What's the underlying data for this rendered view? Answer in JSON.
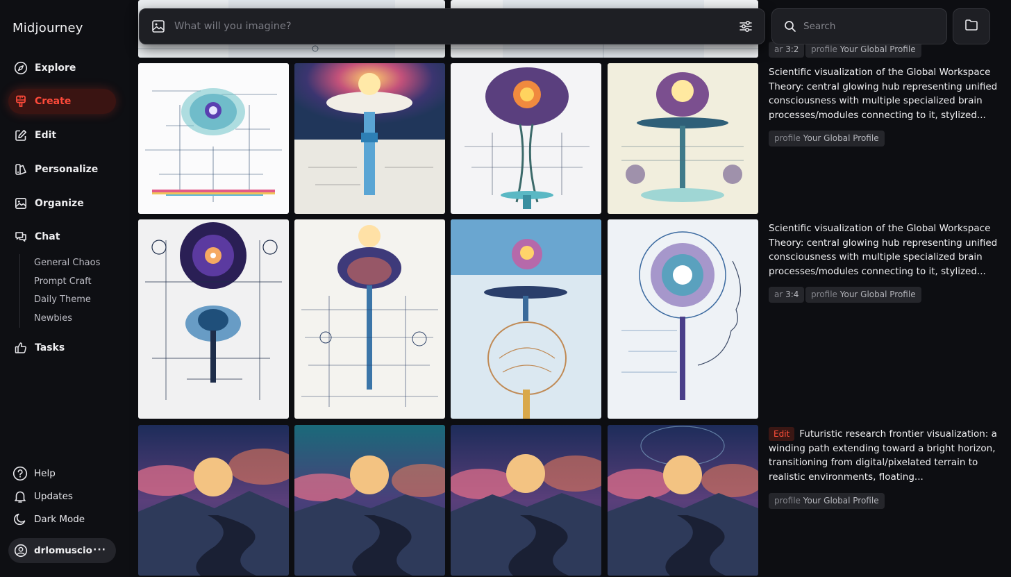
{
  "app": {
    "title": "Midjourney"
  },
  "nav": {
    "items": [
      {
        "label": "Explore",
        "icon": "compass-icon"
      },
      {
        "label": "Create",
        "icon": "brush-icon",
        "active": true
      },
      {
        "label": "Edit",
        "icon": "edit-icon"
      },
      {
        "label": "Personalize",
        "icon": "palette-icon"
      },
      {
        "label": "Organize",
        "icon": "image-icon"
      },
      {
        "label": "Chat",
        "icon": "chat-icon"
      }
    ],
    "chat_channels": [
      "General Chaos",
      "Prompt Craft",
      "Daily Theme",
      "Newbies"
    ],
    "tasks": {
      "label": "Tasks",
      "icon": "thumbs-up-icon"
    }
  },
  "bottom": {
    "help": "Help",
    "updates": "Updates",
    "dark_mode": "Dark Mode",
    "user": "drlomuscio",
    "more": "···"
  },
  "prompt": {
    "placeholder": "What will you imagine?"
  },
  "search": {
    "placeholder": "Search"
  },
  "jobs": [
    {
      "partial": true,
      "tags": [
        {
          "key": "ar",
          "value": "3:2"
        },
        {
          "key": "profile",
          "value": "Your Global Profile"
        }
      ]
    },
    {
      "prompt": "Scientific visualization of the Global Workspace Theory: central glowing hub representing unified consciousness with multiple specialized brain processes/modules connecting to it, stylized...",
      "tags": [
        {
          "key": "profile",
          "value": "Your Global Profile"
        }
      ]
    },
    {
      "prompt": "Scientific visualization of the Global Workspace Theory: central glowing hub representing unified consciousness with multiple specialized brain processes/modules connecting to it, stylized...",
      "tags": [
        {
          "key": "ar",
          "value": "3:4"
        },
        {
          "key": "profile",
          "value": "Your Global Profile"
        }
      ]
    },
    {
      "badge": "Edit",
      "prompt": "Futuristic research frontier visualization: a winding path extending toward a bright horizon, transitioning from digital/pixelated terrain to realistic environments, floating...",
      "tags": [
        {
          "key": "profile",
          "value": "Your Global Profile"
        }
      ]
    }
  ],
  "colors": {
    "accent": "#ff4a3a",
    "background": "#0d0e12",
    "panel": "#1e1f24"
  }
}
